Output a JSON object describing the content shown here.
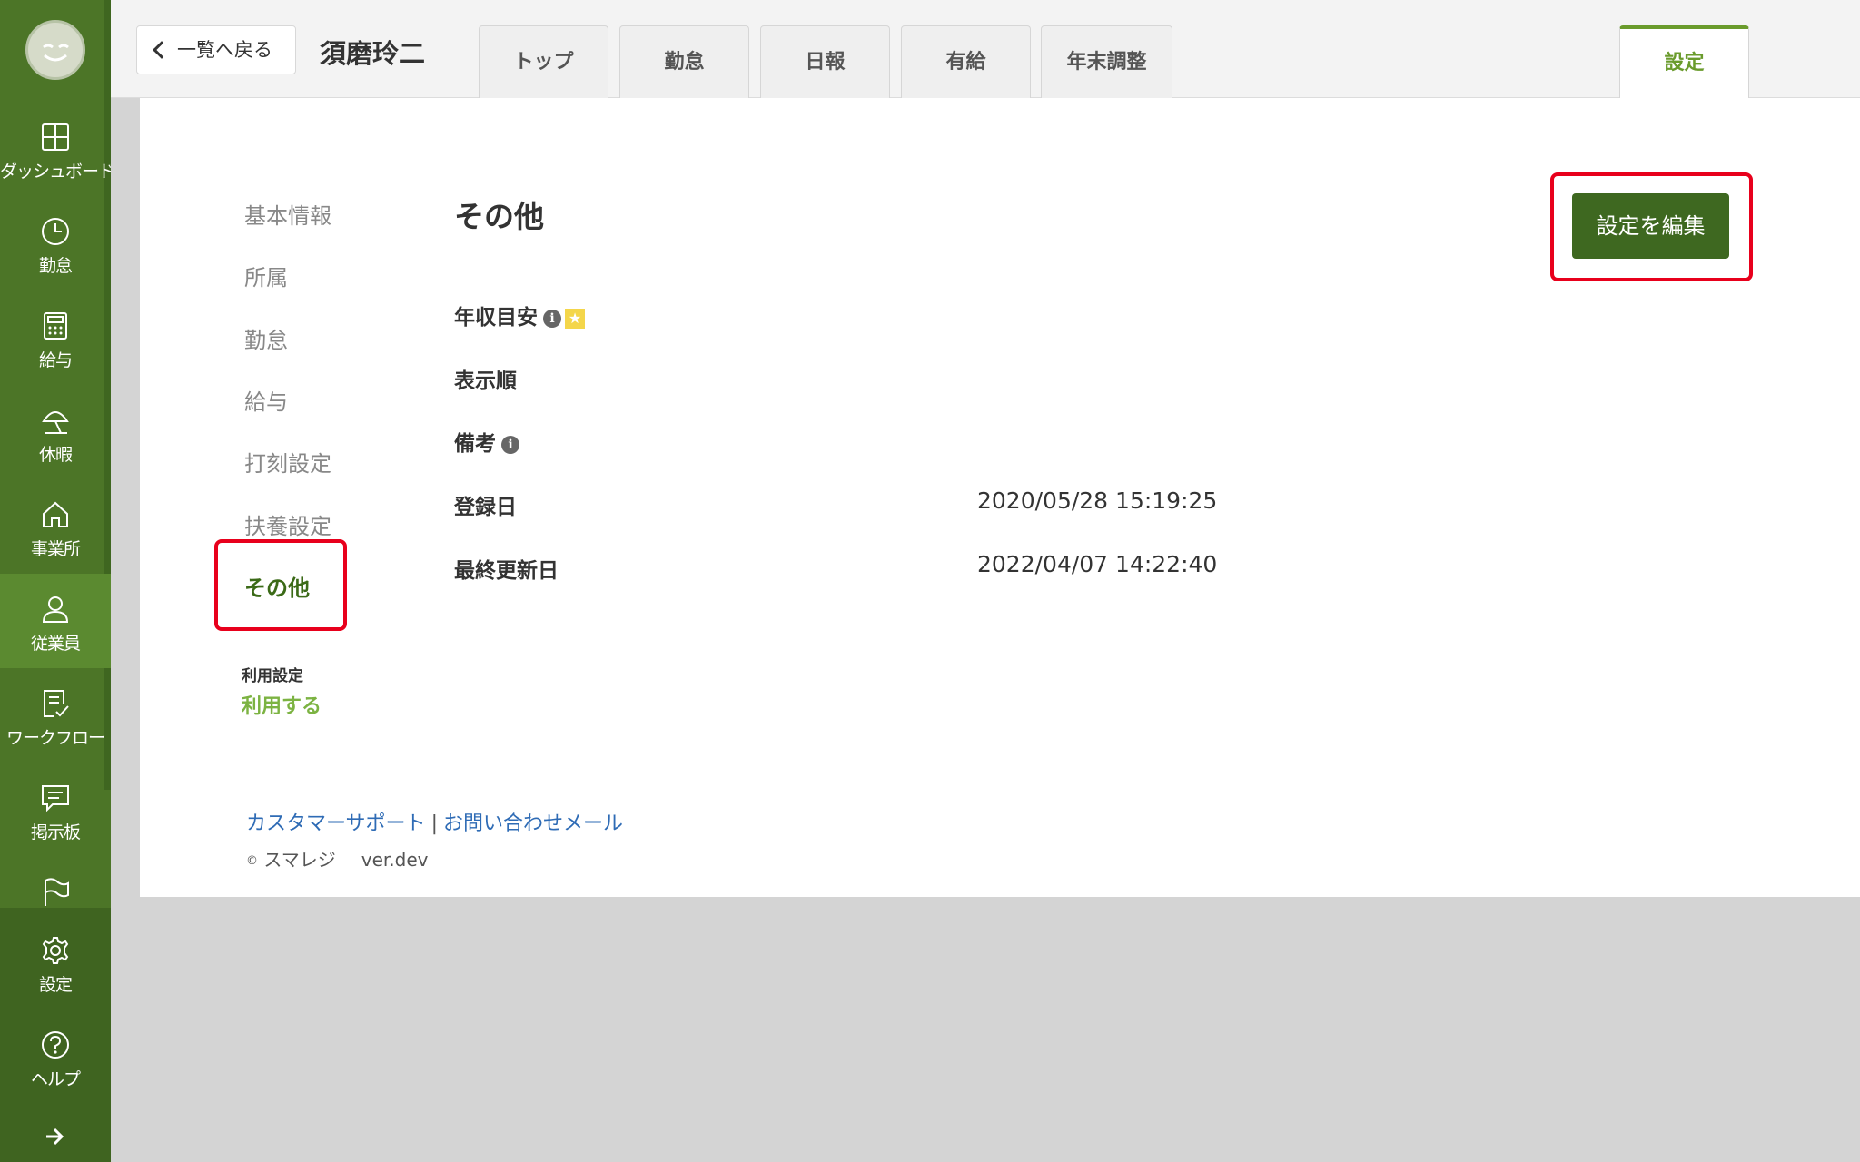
{
  "sidebar": {
    "items": [
      {
        "label": "ダッシュボード",
        "icon": "dashboard-icon"
      },
      {
        "label": "勤怠",
        "icon": "clock-icon"
      },
      {
        "label": "給与",
        "icon": "calculator-icon"
      },
      {
        "label": "休暇",
        "icon": "umbrella-icon"
      },
      {
        "label": "事業所",
        "icon": "home-icon"
      },
      {
        "label": "従業員",
        "icon": "person-icon"
      },
      {
        "label": "ワークフロー",
        "icon": "checklist-icon"
      },
      {
        "label": "掲示板",
        "icon": "message-icon"
      },
      {
        "label": "",
        "icon": "flag-icon"
      },
      {
        "label": "設定",
        "icon": "gear-icon"
      },
      {
        "label": "ヘルプ",
        "icon": "help-icon"
      }
    ],
    "active": "従業員",
    "expand_icon": "arrow-right-icon"
  },
  "header": {
    "back_label": "一覧へ戻る",
    "employee_name": "須磨玲二",
    "tabs": [
      {
        "label": "トップ"
      },
      {
        "label": "勤怠"
      },
      {
        "label": "日報"
      },
      {
        "label": "有給"
      },
      {
        "label": "年末調整"
      }
    ],
    "active_tab": {
      "label": "設定"
    }
  },
  "subnav": {
    "items": [
      {
        "label": "基本情報"
      },
      {
        "label": "所属"
      },
      {
        "label": "勤怠"
      },
      {
        "label": "給与"
      },
      {
        "label": "打刻設定"
      },
      {
        "label": "扶養設定"
      },
      {
        "label": "その他"
      }
    ],
    "active": "その他",
    "usage_label": "利用設定",
    "usage_value": "利用する"
  },
  "main": {
    "title": "その他",
    "edit_button": "設定を編集",
    "fields": [
      {
        "label": "年収目安",
        "value": ""
      },
      {
        "label": "表示順",
        "value": ""
      },
      {
        "label": "備考",
        "value": ""
      },
      {
        "label": "登録日",
        "value": "2020/05/28 15:19:25"
      },
      {
        "label": "最終更新日",
        "value": "2022/04/07 14:22:40"
      }
    ]
  },
  "footer": {
    "support_link": "カスタマーサポート",
    "separator": "|",
    "contact_link": "お問い合わせメール",
    "copyright_symbol": "©",
    "company": "スマレジ",
    "version": "ver.dev"
  },
  "colors": {
    "sidebar": "#4c7527",
    "accent": "#6a9b2c",
    "button": "#3e6820",
    "highlight": "#e8001c",
    "link": "#2e6bb5"
  }
}
